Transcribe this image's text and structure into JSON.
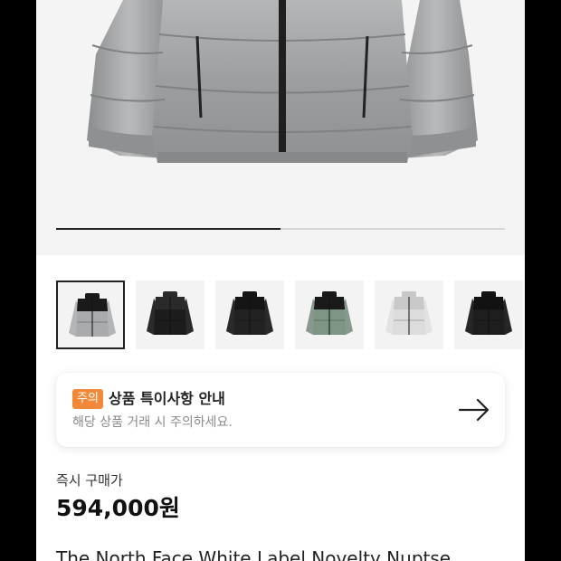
{
  "gallery": {
    "progress": 0.5,
    "thumbnails": [
      {
        "icon": "jacket-silver-black-icon",
        "selected": true
      },
      {
        "icon": "jacket-black-glossy-icon",
        "selected": false
      },
      {
        "icon": "jacket-black-matte-icon",
        "selected": false
      },
      {
        "icon": "jacket-green-black-icon",
        "selected": false
      },
      {
        "icon": "jacket-white-camo-icon",
        "selected": false
      },
      {
        "icon": "jacket-black-icon",
        "selected": false
      }
    ]
  },
  "notice": {
    "badge": "주의",
    "title": "상품 특이사항 안내",
    "description": "해당 상품 거래 시 주의하세요.",
    "arrow_icon": "arrow-right-icon"
  },
  "price": {
    "label": "즉시 구매가",
    "value": "594,000원"
  },
  "product": {
    "name": "The North Face White Label Novelty Nuptse"
  },
  "colors": {
    "badge": "#f08a3a",
    "text_primary": "#111111",
    "text_muted": "#8a8a8a"
  }
}
